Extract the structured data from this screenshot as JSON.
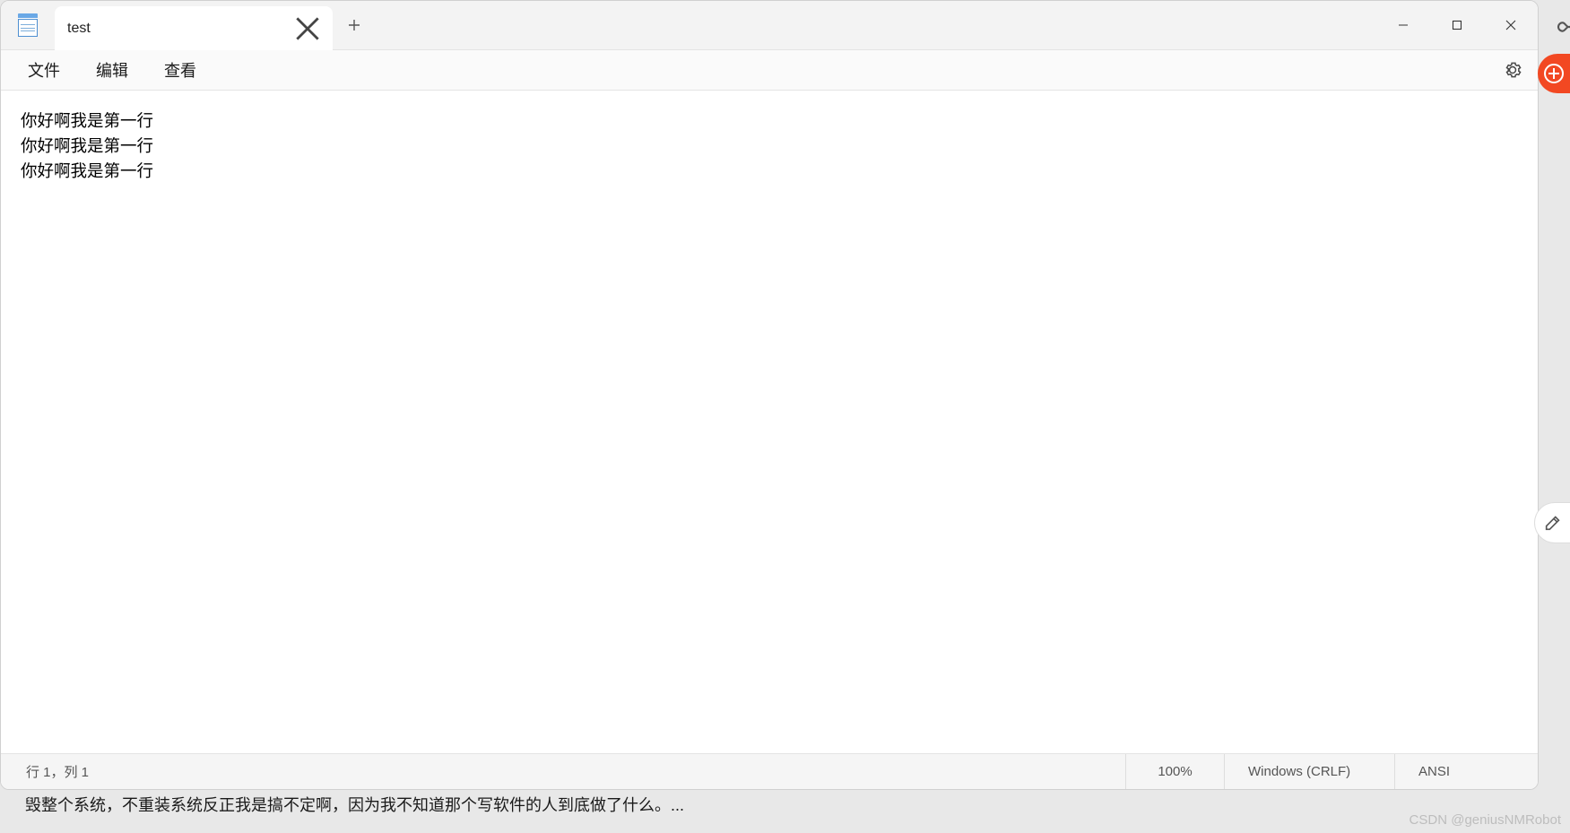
{
  "tab": {
    "title": "test"
  },
  "menu": {
    "file": "文件",
    "edit": "编辑",
    "view": "查看"
  },
  "editor": {
    "lines": [
      "你好啊我是第一行",
      "你好啊我是第一行",
      "你好啊我是第一行"
    ]
  },
  "status": {
    "position": "行 1，列 1",
    "zoom": "100%",
    "eol": "Windows (CRLF)",
    "encoding": "ANSI"
  },
  "background": {
    "snippet": "毁整个系统，不重装系统反正我是搞不定啊，因为我不知道那个写软件的人到底做了什么。..."
  },
  "watermark": "CSDN @geniusNMRobot"
}
